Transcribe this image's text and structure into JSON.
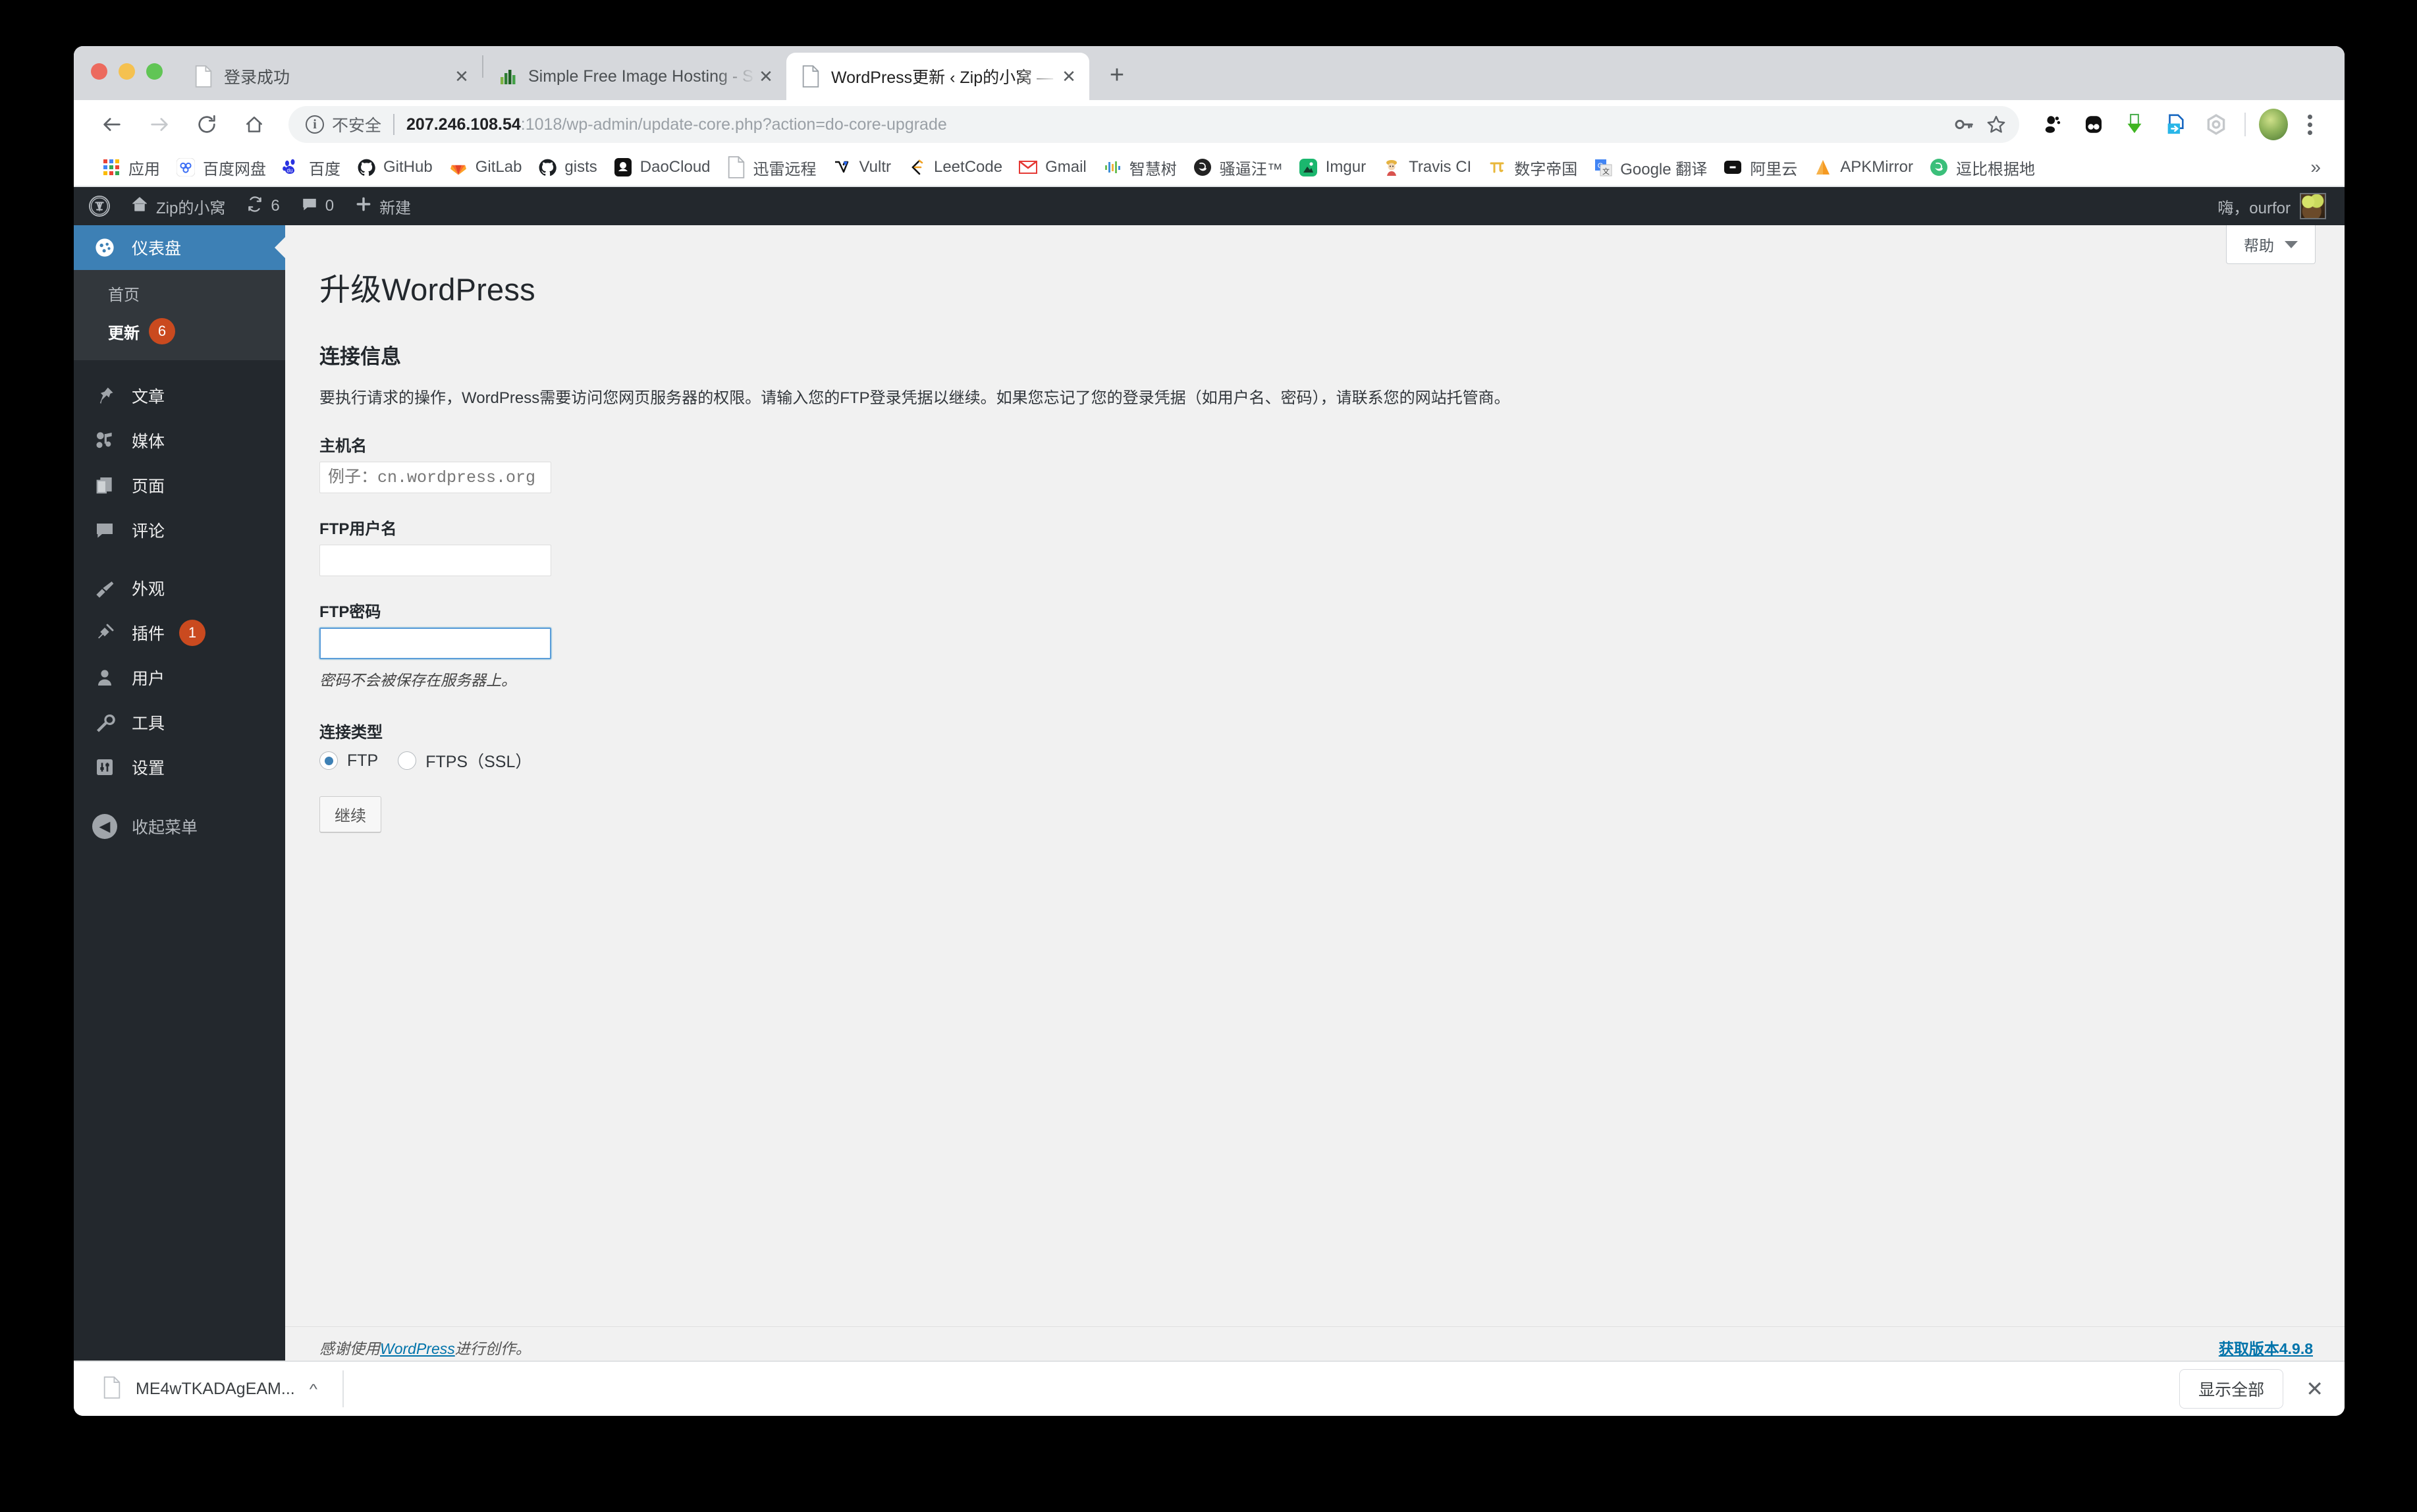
{
  "browser": {
    "tabs": [
      {
        "title": "登录成功",
        "favicon": "document-icon",
        "active": false
      },
      {
        "title": "Simple Free Image Hosting - S",
        "favicon": "bar-chart-icon",
        "active": false
      },
      {
        "title": "WordPress更新 ‹ Zip的小窝 — ",
        "favicon": "document-icon",
        "active": true
      }
    ],
    "new_tab_label": "+",
    "toolbar": {
      "back_icon": "back-arrow-icon",
      "forward_icon": "forward-arrow-icon",
      "reload_icon": "reload-icon",
      "home_icon": "home-icon",
      "security_label": "不安全",
      "url_host": "207.246.108.54",
      "url_rest": ":1018/wp-admin/update-core.php?action=do-core-upgrade",
      "key_icon": "key-icon",
      "star_icon": "star-icon",
      "extensions": [
        "gnome-foot-icon",
        "panda-icon",
        "green-download-arrow-icon",
        "blue-page-arrow-icon",
        "grey-hexagon-icon"
      ],
      "profile_icon": "profile-avatar",
      "menu_icon": "three-dot-menu-icon"
    },
    "bookmarks": [
      {
        "label": "应用",
        "icon": "apps-grid-icon"
      },
      {
        "label": "百度网盘",
        "icon": "baidu-pan-icon"
      },
      {
        "label": "百度",
        "icon": "baidu-paw-icon"
      },
      {
        "label": "GitHub",
        "icon": "github-icon"
      },
      {
        "label": "GitLab",
        "icon": "gitlab-icon"
      },
      {
        "label": "gists",
        "icon": "github-icon"
      },
      {
        "label": "DaoCloud",
        "icon": "daocloud-icon"
      },
      {
        "label": "迅雷远程",
        "icon": "document-icon"
      },
      {
        "label": "Vultr",
        "icon": "vultr-icon"
      },
      {
        "label": "LeetCode",
        "icon": "leetcode-icon"
      },
      {
        "label": "Gmail",
        "icon": "gmail-icon"
      },
      {
        "label": "智慧树",
        "icon": "zhihuishu-icon"
      },
      {
        "label": "骚逼汪™",
        "icon": "black-circle-icon"
      },
      {
        "label": "Imgur",
        "icon": "imgur-icon"
      },
      {
        "label": "Travis CI",
        "icon": "travis-ci-icon"
      },
      {
        "label": "数字帝国",
        "icon": "pi-icon"
      },
      {
        "label": "Google 翻译",
        "icon": "google-translate-icon"
      },
      {
        "label": "阿里云",
        "icon": "aliyun-icon"
      },
      {
        "label": "APKMirror",
        "icon": "apkmirror-icon"
      },
      {
        "label": "逗比根据地",
        "icon": "green-circle-icon"
      }
    ],
    "bookmarks_overflow": "»"
  },
  "wp_adminbar": {
    "logo_icon": "wordpress-logo-icon",
    "site_icon": "home-icon",
    "site_name": "Zip的小窝",
    "updates_icon": "update-arrows-icon",
    "updates_count": "6",
    "comments_icon": "comment-bubble-icon",
    "comments_count": "0",
    "new_icon": "plus-icon",
    "new_label": "新建",
    "greeting": "嗨，ourfor",
    "avatar_icon": "user-avatar"
  },
  "sidebar": {
    "dashboard": {
      "label": "仪表盘",
      "icon": "dashboard-icon"
    },
    "submenu": [
      {
        "label": "首页",
        "current": false,
        "badge": ""
      },
      {
        "label": "更新",
        "current": true,
        "badge": "6"
      }
    ],
    "items": [
      {
        "label": "文章",
        "icon": "pin-icon",
        "badge": ""
      },
      {
        "label": "媒体",
        "icon": "media-icon",
        "badge": ""
      },
      {
        "label": "页面",
        "icon": "pages-icon",
        "badge": ""
      },
      {
        "label": "评论",
        "icon": "comment-bubble-icon",
        "badge": ""
      },
      {
        "label": "外观",
        "icon": "appearance-brush-icon",
        "badge": ""
      },
      {
        "label": "插件",
        "icon": "plugin-plug-icon",
        "badge": "1"
      },
      {
        "label": "用户",
        "icon": "user-icon",
        "badge": ""
      },
      {
        "label": "工具",
        "icon": "wrench-icon",
        "badge": ""
      },
      {
        "label": "设置",
        "icon": "settings-sliders-icon",
        "badge": ""
      }
    ],
    "collapse": {
      "label": "收起菜单",
      "icon": "collapse-left-icon"
    }
  },
  "content": {
    "help_tab": "帮助",
    "page_title": "升级WordPress",
    "section_title": "连接信息",
    "intro": "要执行请求的操作，WordPress需要访问您网页服务器的权限。请输入您的FTP登录凭据以继续。如果您忘记了您的登录凭据（如用户名、密码），请联系您的网站托管商。",
    "fields": {
      "hostname": {
        "label": "主机名",
        "value": "",
        "placeholder": "例子：cn.wordpress.org"
      },
      "ftp_user": {
        "label": "FTP用户名",
        "value": "",
        "placeholder": ""
      },
      "ftp_pass": {
        "label": "FTP密码",
        "value": "",
        "placeholder": "",
        "note": "密码不会被保存在服务器上。"
      }
    },
    "connection_type": {
      "label": "连接类型",
      "options": [
        {
          "label": "FTP",
          "checked": true
        },
        {
          "label": "FTPS（SSL）",
          "checked": false
        }
      ]
    },
    "submit_label": "继续"
  },
  "footer": {
    "left_prefix": "感谢使用",
    "left_link": "WordPress",
    "left_suffix": "进行创作。",
    "right": "获取版本4.9.8"
  },
  "download_shelf": {
    "filename": "ME4wTKADAgEAM...",
    "caret": "^",
    "show_all_label": "显示全部",
    "close_label": "✕",
    "file_icon": "document-icon"
  }
}
